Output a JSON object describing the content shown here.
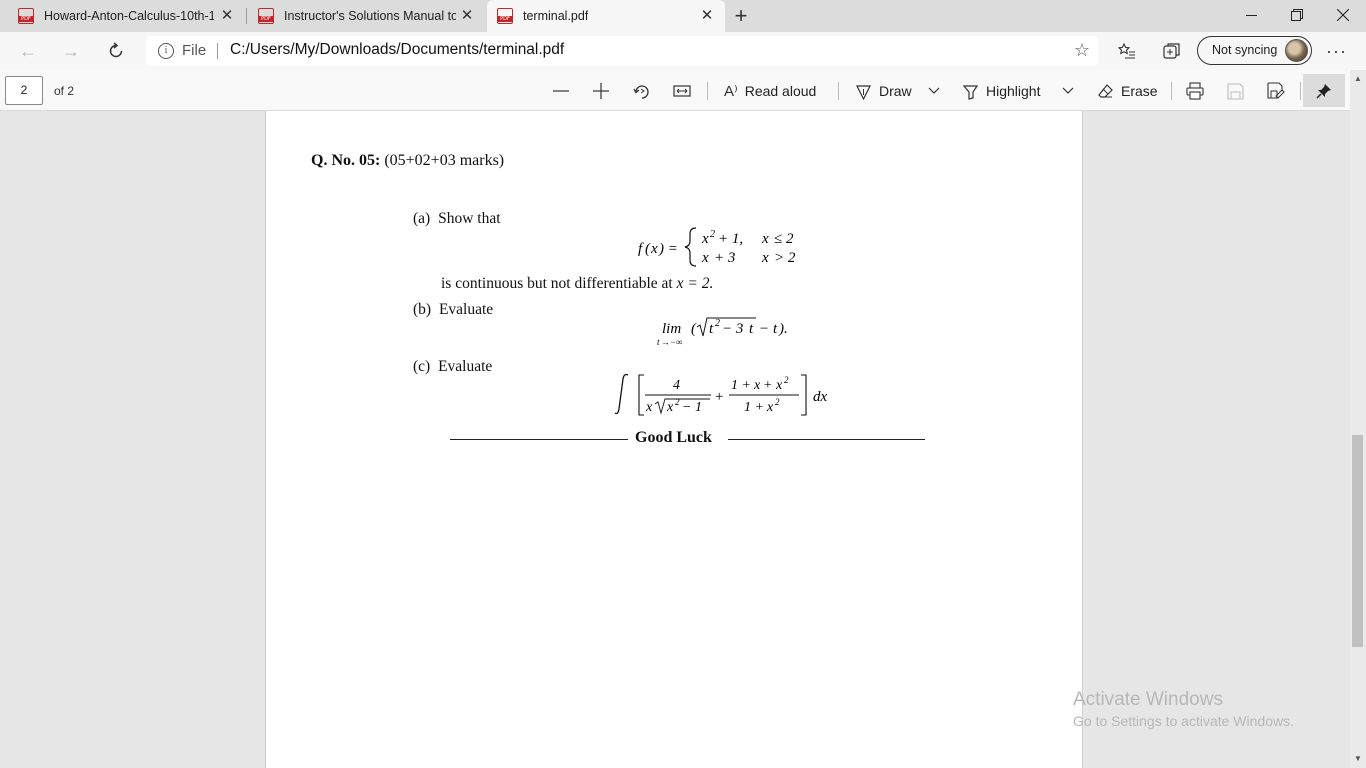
{
  "browser": {
    "tabs": [
      {
        "title": "Howard-Anton-Calculus-10th-1",
        "active": false
      },
      {
        "title": "Instructor's Solutions Manual to",
        "active": false
      },
      {
        "title": "terminal.pdf",
        "active": true
      }
    ],
    "url_scheme": "File",
    "url": "C:/Users/My/Downloads/Documents/terminal.pdf",
    "sync_label": "Not syncing"
  },
  "pdf_toolbar": {
    "current_page": "2",
    "page_count": "of 2",
    "read_aloud": "Read aloud",
    "draw": "Draw",
    "highlight": "Highlight",
    "erase": "Erase"
  },
  "document": {
    "question_heading": "Q. No. 05:",
    "question_marks": "(05+02+03 marks)",
    "part_a_label": "(a)",
    "part_a_text": "Show that",
    "part_a_conclusion": "is continuous but not differentiable at",
    "part_a_point": "x = 2.",
    "part_b_label": "(b)",
    "part_b_text": "Evaluate",
    "part_c_label": "(c)",
    "part_c_text": "Evaluate",
    "closing": "Good Luck"
  },
  "watermark": {
    "title": "Activate Windows",
    "subtitle": "Go to Settings to activate Windows."
  }
}
